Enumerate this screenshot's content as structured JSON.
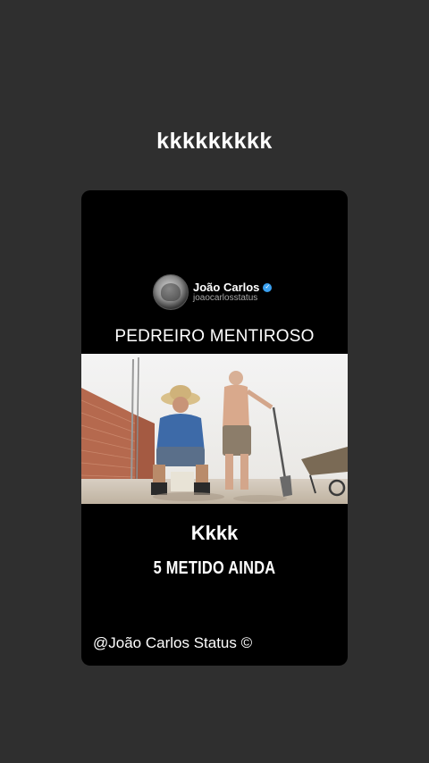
{
  "story": {
    "caption": "kkkkkkkkk"
  },
  "post": {
    "profile": {
      "name": "João Carlos",
      "handle": "joaocarlosstatus",
      "verified_icon": "verified-badge-icon"
    },
    "headline": "PEDREIRO MENTIROSO",
    "photo": {
      "subject": "two-masons-at-construction-site"
    },
    "text_main": "Kkkk",
    "text_sub": "5 METIDO AINDA",
    "watermark": "@João Carlos Status ©"
  },
  "colors": {
    "background": "#2f2f2f",
    "card": "#000000",
    "text": "#ffffff",
    "verified": "#3aa0f0"
  }
}
